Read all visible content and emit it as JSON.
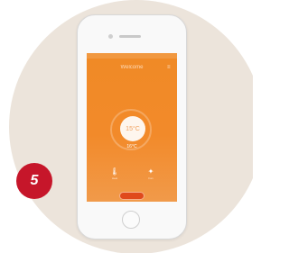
{
  "step": {
    "number": "5"
  },
  "phone": {
    "screen": {
      "title": "Welcome",
      "menu_icon": "≡",
      "dial_value": "15°C",
      "dial_subtext": "16°C",
      "left_control": {
        "icon": "thermometer-icon",
        "glyph": "🌡",
        "label": "Heat"
      },
      "right_control": {
        "icon": "fan-icon",
        "glyph": "✦",
        "label": "Fan"
      },
      "bottom_button_label": ""
    }
  },
  "colors": {
    "accent": "#f08a26",
    "badge": "#c6162a",
    "background_circle": "#ece4db"
  }
}
